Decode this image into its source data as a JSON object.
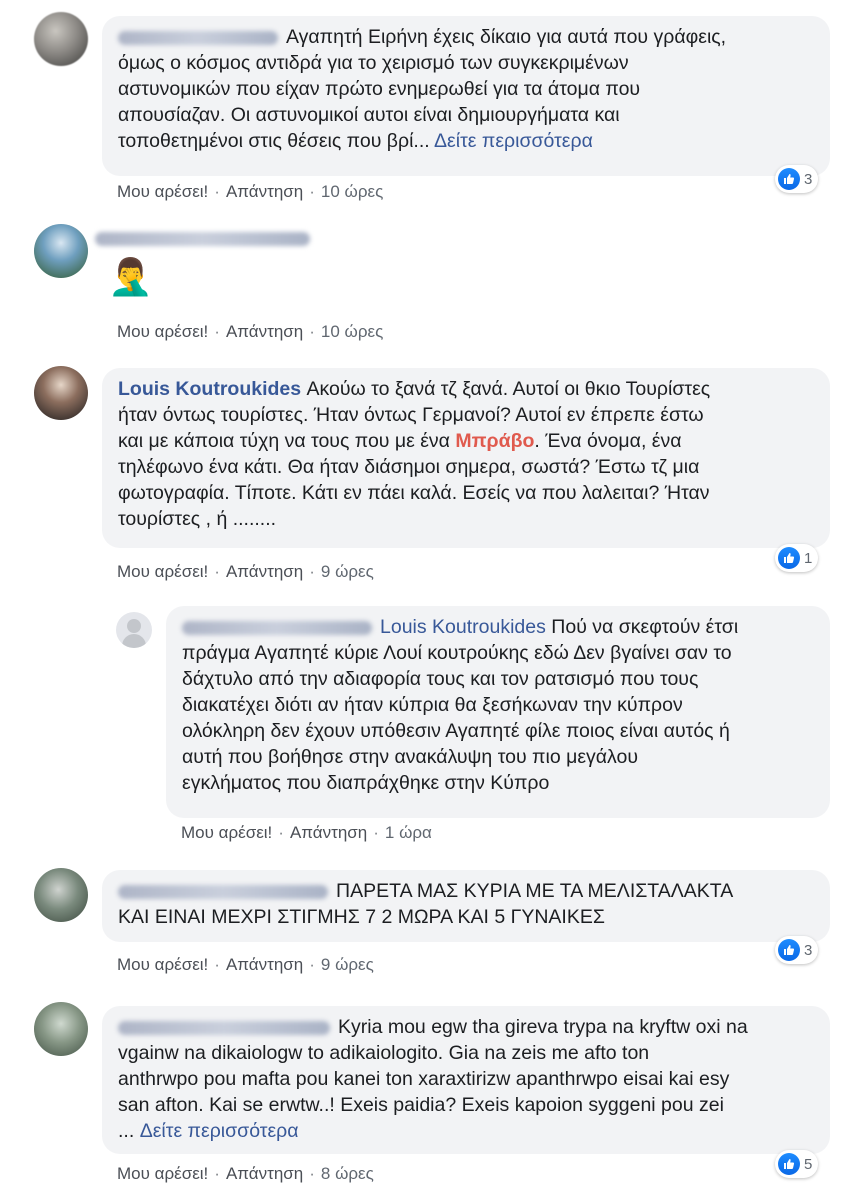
{
  "actions": {
    "like": "Μου αρέσει!",
    "reply": "Απάντηση",
    "sep": "·"
  },
  "comments": [
    {
      "text": "Αγαπητή Ειρήνη έχεις δίκαιο για αυτά που γράφεις, όμως ο κόσμος αντιδρά για το χειρισμό των συγκεκριμένων αστυνομικών που είχαν πρώτο ενημερωθεί για τα άτομα που απουσίαζαν. Οι αστυνομικοί αυτοί είναι δημιουργήματα και τοποθετημένοι στις θέσεις που βρί...",
      "line1": "Αγαπητή Ειρήνη έχεις δίκαιο για αυτά που γράφεις,",
      "line2": "όμως ο κόσμος αντιδρά για το χειρισμό των συγκεκριμένων",
      "line3": "αστυνομικών που είχαν πρώτο ενημερωθεί για τα άτομα που",
      "line4": "απουσίαζαν. Οι αστυνομικοί αυτοι είναι δημιουργήματα και",
      "line5": "τοποθετημένοι στις θέσεις που βρί...",
      "see_more": "Δείτε περισσότερα",
      "time": "10 ώρες",
      "reactions": "3"
    },
    {
      "emoji": "🤦‍♂️",
      "time": "10 ώρες"
    },
    {
      "author": "Louis Koutroukides",
      "line1": "Ακούω το ξανά τζ ξανά. Αυτοί οι θκιο Τουρίστες",
      "line2": "ήταν όντως τουρίστες. Ήταν όντως Γερμανοί? Αυτοί εν έπρεπε έστω",
      "line3a": "και με κάποια τύχη να τους που με ένα",
      "bravo": "Μπράβο",
      "line3b": ". Ένα όνομα, ένα",
      "line4": "τηλέφωνο ένα κάτι. Θα ήταν διάσημοι σημερα, σωστά? Έστω τζ μια",
      "line5": "φωτογραφία. Τίποτε. Κάτι εν πάει καλά. Εσείς να που λαλειται? Ήταν",
      "line6": "τουρίστες , ή ........",
      "time": "9 ώρες",
      "reactions": "1"
    },
    {
      "mention": "Louis Koutroukides",
      "line1": "Πού να σκεφτούν έτσι",
      "line2": "πράγμα Αγαπητέ κύριε Λουί κουτρούκης εδώ Δεν βγαίνει σαν το",
      "line3": "δάχτυλο από την αδιαφορία τους και τον ρατσισμό που τους",
      "line4": "διακατέχει διότι αν ήταν κύπρια θα ξεσήκωναν την κύπρον",
      "line5": "ολόκληρη δεν έχουν υπόθεσιν Αγαπητέ φίλε ποιος είναι αυτός ή",
      "line6": "αυτή που βοήθησε στην ανακάλυψη του πιο μεγάλου",
      "line7": "εγκλήματος που διαπράχθηκε στην Κύπρο",
      "time": "1 ώρα"
    },
    {
      "line1": "ΠΑΡΕΤΑ ΜΑΣ ΚΥΡΙΑ ΜΕ ΤΑ ΜΕΛΙΣΤΑΛΑΚΤΑ",
      "line2": "ΚΑΙ ΕΙΝΑΙ ΜΕΧΡΙ ΣΤΙΓΜΗΣ 7 2 ΜΩΡΑ ΚΑΙ 5 ΓΥΝΑΙΚΕΣ",
      "time": "9 ώρες",
      "reactions": "3"
    },
    {
      "line1": "Kyria mou egw tha gireva trypa na kryftw oxi na",
      "line2": "vgainw na dikaiologw to adikaiologito. Gia na zeis me afto ton",
      "line3": "anthrwpo pou mafta pou kanei ton xaraxtirizw apanthrwpo eisai kai esy",
      "line4": "san afton. Kai se erwtw..! Exeis paidia? Exeis kapoion syggeni pou zei",
      "line5": "...",
      "see_more": "Δείτε περισσότερα",
      "time": "8 ώρες",
      "reactions": "5"
    }
  ]
}
